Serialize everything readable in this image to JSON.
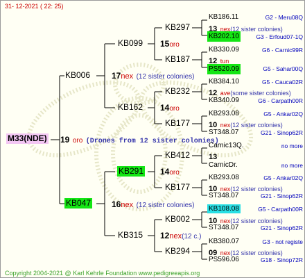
{
  "date": "31- 12-2021 ( 22: 25)",
  "root": {
    "label": "M33(NDE)",
    "num": "19",
    "race": "oro",
    "note": "(Drones from 12 sister colonies)"
  },
  "gen1": [
    {
      "label": "KB006",
      "num": "17",
      "race": "nex",
      "note": "(12 sister colonies)"
    },
    {
      "label": "KB047",
      "num": "16",
      "race": "nex",
      "note": "(12 sister colonies)"
    }
  ],
  "gen2": [
    {
      "label": "KB099",
      "num": "15",
      "race": "oro"
    },
    {
      "label": "KB162",
      "num": "14",
      "race": "oro"
    },
    {
      "label": "KB291",
      "num": "14",
      "race": "oro"
    },
    {
      "label": "KB315",
      "num": "12",
      "race": "nex",
      "note": "(12 c.)"
    }
  ],
  "gen3": [
    {
      "label": "KB297",
      "num": "13",
      "race": "nex",
      "note": "(12 sister colonies)"
    },
    {
      "label": "KB187",
      "num": "12",
      "race": "tun"
    },
    {
      "label": "KB232",
      "num": "12",
      "race": "ave",
      "note": "(some sister colonies)"
    },
    {
      "label": "KB177",
      "num": "10",
      "race": "nex",
      "note": "(12 sister colonies)"
    },
    {
      "label": "KB412",
      "num": "13",
      "race": ""
    },
    {
      "label": "KB177",
      "num": "10",
      "race": "nex",
      "note": "(12 sister colonies)"
    },
    {
      "label": "KB002",
      "num": "10",
      "race": "nex",
      "note": "(12 sister colonies)"
    },
    {
      "label": "KB294",
      "num": "09",
      "race": "nex",
      "note": "(12 sister colonies)"
    }
  ],
  "gen4": [
    {
      "id": "KB186.11",
      "meta": "G2 - Meru08Q"
    },
    {
      "id": "KB202.10",
      "meta": "G3 - Erfoud07-1Q"
    },
    {
      "id": "KB330.09",
      "meta": "G6 - Carnic99R"
    },
    {
      "id": "PS520.09",
      "meta": "G5 - Sahar00Q"
    },
    {
      "id": "KB384.10",
      "meta": "G5 - Cauca02R"
    },
    {
      "id": "KB340.09",
      "meta": "G6 - Carpath00R"
    },
    {
      "id": "KB293.08",
      "meta": "G5 - Ankar02Q"
    },
    {
      "id": "ST348.07",
      "meta": "G21 - Sinop62R"
    },
    {
      "id": "Carnic13Q.",
      "meta": "no more"
    },
    {
      "id": "CarnicDr.",
      "meta": "no more"
    },
    {
      "id": "KB293.08",
      "meta": "G5 - Ankar02Q"
    },
    {
      "id": "ST348.07",
      "meta": "G21 - Sinop62R"
    },
    {
      "id": "KB108.08",
      "meta": "G5 - Carpath00R"
    },
    {
      "id": "ST348.07",
      "meta": "G21 - Sinop62R"
    },
    {
      "id": "KB380.07",
      "meta": "G3 - not registe"
    },
    {
      "id": "PS596.06",
      "meta": "G18 - Sinop72R"
    }
  ],
  "footer": "Copyright 2004-2021 @ Karl Kehrle Foundation    www.pedigreeapis.org",
  "colors": {
    "background": "#fffff4",
    "root_highlight": "#f3c6f3",
    "green_highlight": "#14e614",
    "cyan_highlight": "#29dfe4",
    "race_text": "#cc0000",
    "comment_text": "#3333aa",
    "meta_text": "#0000bb"
  }
}
